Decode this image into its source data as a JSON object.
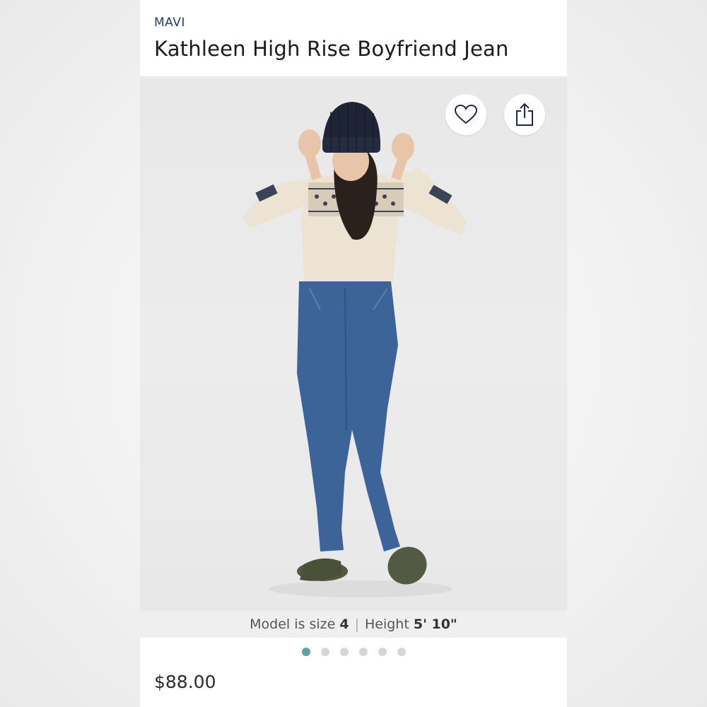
{
  "product": {
    "brand": "MAVI",
    "title": "Kathleen High Rise Boyfriend Jean",
    "price": "$88.00"
  },
  "image": {
    "alt": "Model wearing jeans",
    "caption": {
      "prefix": "Model is size",
      "size": "4",
      "separator": "|",
      "height_label": "Height",
      "height": "5' 10\""
    },
    "carousel": {
      "total": 6,
      "active_index": 0
    }
  },
  "actions": {
    "favorite_icon": "heart-icon",
    "share_icon": "share-icon"
  },
  "colors": {
    "brand": "#1f3a7a",
    "active_dot": "#5ea3a0",
    "inactive_dot": "#d6d6d6"
  }
}
